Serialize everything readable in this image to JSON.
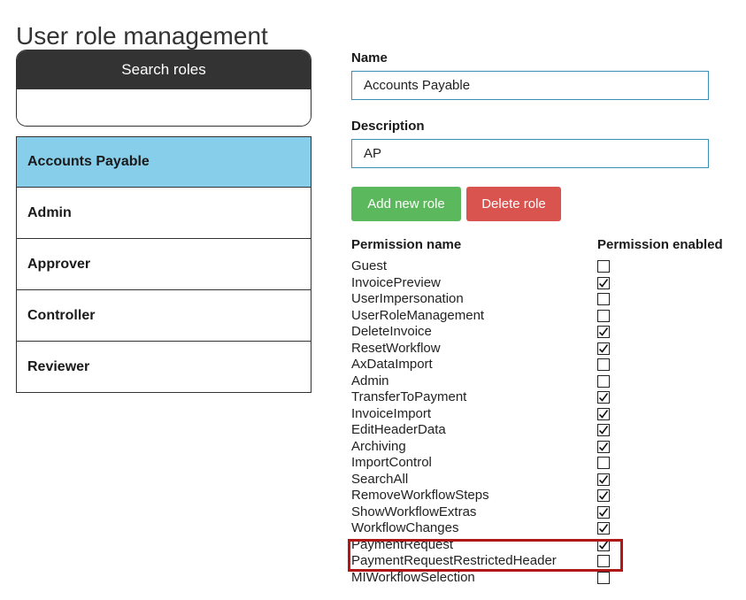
{
  "page": {
    "title": "User role management"
  },
  "search": {
    "header": "Search roles",
    "value": "",
    "placeholder": ""
  },
  "roles": [
    {
      "label": "Accounts Payable",
      "selected": true
    },
    {
      "label": "Admin",
      "selected": false
    },
    {
      "label": "Approver",
      "selected": false
    },
    {
      "label": "Controller",
      "selected": false
    },
    {
      "label": "Reviewer",
      "selected": false
    }
  ],
  "form": {
    "name_label": "Name",
    "name_value": "Accounts Payable",
    "description_label": "Description",
    "description_value": "AP",
    "add_button": "Add new role",
    "delete_button": "Delete role"
  },
  "permissions": {
    "header_name": "Permission name",
    "header_enabled": "Permission enabled",
    "items": [
      {
        "name": "Guest",
        "enabled": false
      },
      {
        "name": "InvoicePreview",
        "enabled": true
      },
      {
        "name": "UserImpersonation",
        "enabled": false
      },
      {
        "name": "UserRoleManagement",
        "enabled": false
      },
      {
        "name": "DeleteInvoice",
        "enabled": true
      },
      {
        "name": "ResetWorkflow",
        "enabled": true
      },
      {
        "name": "AxDataImport",
        "enabled": false
      },
      {
        "name": "Admin",
        "enabled": false
      },
      {
        "name": "TransferToPayment",
        "enabled": true
      },
      {
        "name": "InvoiceImport",
        "enabled": true
      },
      {
        "name": "EditHeaderData",
        "enabled": true
      },
      {
        "name": "Archiving",
        "enabled": true
      },
      {
        "name": "ImportControl",
        "enabled": false
      },
      {
        "name": "SearchAll",
        "enabled": true
      },
      {
        "name": "RemoveWorkflowSteps",
        "enabled": true
      },
      {
        "name": "ShowWorkflowExtras",
        "enabled": true
      },
      {
        "name": "WorkflowChanges",
        "enabled": true
      },
      {
        "name": "PaymentRequest",
        "enabled": true
      },
      {
        "name": "PaymentRequestRestrictedHeader",
        "enabled": false
      },
      {
        "name": "MIWorkflowSelection",
        "enabled": false
      }
    ]
  },
  "colors": {
    "selected_role": "#87ceeb",
    "add_button": "#5cb85c",
    "delete_button": "#d9534f",
    "highlight_box": "#b01818",
    "search_header": "#333333"
  }
}
